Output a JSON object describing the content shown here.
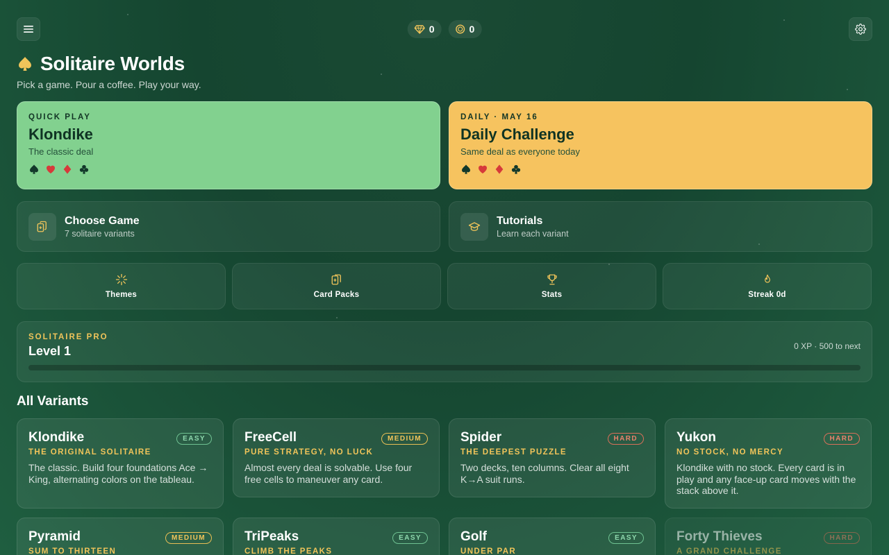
{
  "topbar": {
    "menu_icon": "hamburger-menu-icon",
    "settings_icon": "gear-icon",
    "gems": {
      "icon": "diamond-icon",
      "count": "0"
    },
    "coins": {
      "icon": "coin-icon",
      "count": "0"
    }
  },
  "header": {
    "icon": "spade-icon",
    "title": "Solitaire Worlds",
    "subtitle": "Pick a game. Pour a coffee. Play your way."
  },
  "hero": {
    "quick": {
      "kicker": "QUICK PLAY",
      "title": "Klondike",
      "subtitle": "The classic deal"
    },
    "daily": {
      "kicker": "DAILY · MAY 16",
      "title": "Daily Challenge",
      "subtitle": "Same deal as everyone today"
    }
  },
  "wide": {
    "choose": {
      "icon": "cards-icon",
      "title": "Choose Game",
      "subtitle": "7 solitaire variants"
    },
    "tutorials": {
      "icon": "graduation-cap-icon",
      "title": "Tutorials",
      "subtitle": "Learn each variant"
    }
  },
  "tiles": [
    {
      "icon": "sparkle-icon",
      "label": "Themes"
    },
    {
      "icon": "card-packs-icon",
      "label": "Card Packs"
    },
    {
      "icon": "trophy-icon",
      "label": "Stats"
    },
    {
      "icon": "flame-icon",
      "label": "Streak 0d"
    }
  ],
  "pro": {
    "kicker": "SOLITAIRE PRO",
    "level": "Level 1",
    "xp_text": "0 XP · 500 to next",
    "progress_fraction": 0
  },
  "variants_title": "All Variants",
  "variants": [
    {
      "name": "Klondike",
      "tagline": "THE ORIGINAL SOLITAIRE",
      "difficulty": "EASY",
      "description": "The classic. Build four foundations Ace → King, alternating colors on the tableau."
    },
    {
      "name": "FreeCell",
      "tagline": "PURE STRATEGY, NO LUCK",
      "difficulty": "MEDIUM",
      "description": "Almost every deal is solvable. Use four free cells to maneuver any card."
    },
    {
      "name": "Spider",
      "tagline": "THE DEEPEST PUZZLE",
      "difficulty": "HARD",
      "description": "Two decks, ten columns. Clear all eight K→A suit runs."
    },
    {
      "name": "Yukon",
      "tagline": "NO STOCK, NO MERCY",
      "difficulty": "HARD",
      "description": "Klondike with no stock. Every card is in play and any face-up card moves with the stack above it."
    },
    {
      "name": "Pyramid",
      "tagline": "SUM TO THIRTEEN",
      "difficulty": "MEDIUM",
      "description": ""
    },
    {
      "name": "TriPeaks",
      "tagline": "CLIMB THE PEAKS",
      "difficulty": "EASY",
      "description": ""
    },
    {
      "name": "Golf",
      "tagline": "UNDER PAR",
      "difficulty": "EASY",
      "description": ""
    },
    {
      "name": "Forty Thieves",
      "tagline": "A GRAND CHALLENGE",
      "difficulty": "HARD",
      "description": ""
    }
  ],
  "colors": {
    "accent_gold": "#f0c45a",
    "quick_play": "#82d18f",
    "daily": "#f6c35f",
    "suit_red": "#d63a3a",
    "suit_dark": "#12382a"
  }
}
